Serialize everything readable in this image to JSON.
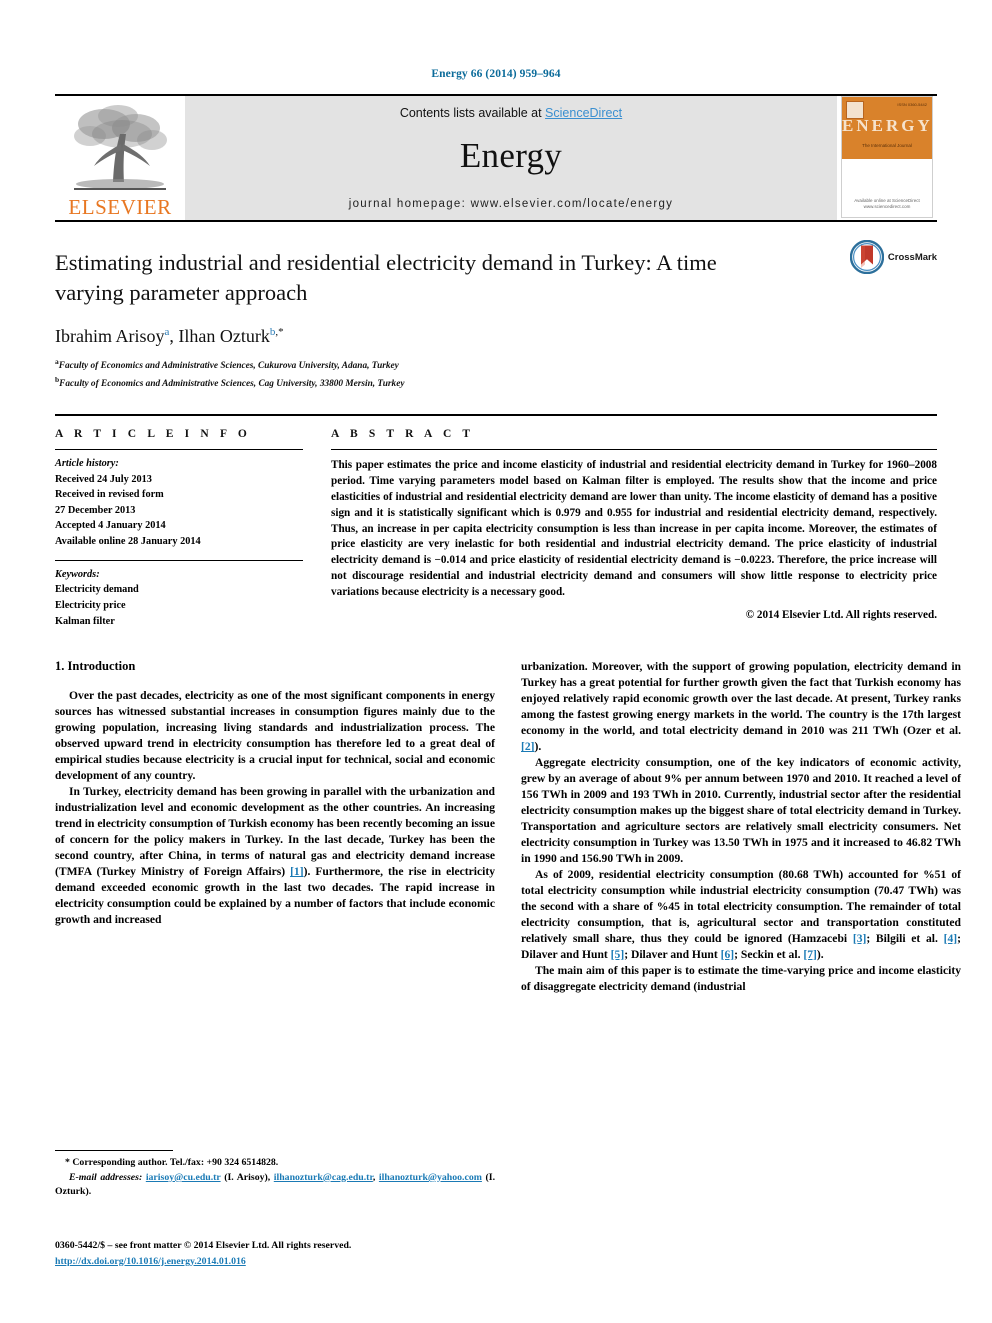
{
  "running_head": "Energy 66 (2014) 959–964",
  "masthead": {
    "publisher_name": "ELSEVIER",
    "contents_prefix": "Contents lists available at ",
    "sciencedirect": "ScienceDirect",
    "journal_name": "Energy",
    "homepage": "journal homepage: www.elsevier.com/locate/energy",
    "cover": {
      "title": "ENERGY",
      "issn": "ISSN 0360-5442",
      "subtitle": "The International Journal",
      "footer": "Available online at\nScienceDirect\nwww.sciencedirect.com"
    }
  },
  "article": {
    "title": "Estimating industrial and residential electricity demand in Turkey: A time varying parameter approach",
    "authors_plain": "Ibrahim Arisoy",
    "author1": "Ibrahim Arisoy",
    "author1_sup": "a",
    "author2": "Ilhan Ozturk",
    "author2_sup": "b",
    "author2_star": ",*",
    "affiliation_a_sup": "a",
    "affiliation_a": "Faculty of Economics and Administrative Sciences, Cukurova University, Adana, Turkey",
    "affiliation_b_sup": "b",
    "affiliation_b": "Faculty of Economics and Administrative Sciences, Cag University, 33800 Mersin, Turkey",
    "crossmark_label": "CrossMark"
  },
  "article_info": {
    "heading": "A R T I C L E   I N F O",
    "history_label": "Article history:",
    "history": [
      "Received 24 July 2013",
      "Received in revised form",
      "27 December 2013",
      "Accepted 4 January 2014",
      "Available online 28 January 2014"
    ],
    "keywords_label": "Keywords:",
    "keywords": [
      "Electricity demand",
      "Electricity price",
      "Kalman filter"
    ]
  },
  "abstract": {
    "heading": "A B S T R A C T",
    "text": "This paper estimates the price and income elasticity of industrial and residential electricity demand in Turkey for 1960–2008 period. Time varying parameters model based on Kalman filter is employed. The results show that the income and price elasticities of industrial and residential electricity demand are lower than unity. The income elasticity of demand has a positive sign and it is statistically significant which is 0.979 and 0.955 for industrial and residential electricity demand, respectively. Thus, an increase in per capita electricity consumption is less than increase in per capita income. Moreover, the estimates of price elasticity are very inelastic for both residential and industrial electricity demand. The price elasticity of industrial electricity demand is −0.014 and price elasticity of residential electricity demand is −0.0223. Therefore, the price increase will not discourage residential and industrial electricity demand and consumers will show little response to electricity price variations because electricity is a necessary good.",
    "copyright": "© 2014 Elsevier Ltd. All rights reserved."
  },
  "body": {
    "section_heading": "1. Introduction",
    "left_paragraphs": [
      "Over the past decades, electricity as one of the most significant components in energy sources has witnessed substantial increases in consumption figures mainly due to the growing population, increasing living standards and industrialization process. The observed upward trend in electricity consumption has therefore led to a great deal of empirical studies because electricity is a crucial input for technical, social and economic development of any country."
    ],
    "left_p2_part1": "In Turkey, electricity demand has been growing in parallel with the urbanization and industrialization level and economic development as the other countries. An increasing trend in electricity consumption of Turkish economy has been recently becoming an issue of concern for the policy makers in Turkey. In the last decade, Turkey has been the second country, after China, in terms of natural gas and electricity demand increase (TMFA (Turkey Ministry of Foreign Affairs) ",
    "left_p2_ref": "[1]",
    "left_p2_part2": "). Furthermore, the rise in electricity demand exceeded economic growth in the last two decades. The rapid increase in electricity consumption could be explained by a number of factors that include economic growth and increased",
    "right_p1_part1": "urbanization. Moreover, with the support of growing population, electricity demand in Turkey has a great potential for further growth given the fact that Turkish economy has enjoyed relatively rapid economic growth over the last decade. At present, Turkey ranks among the fastest growing energy markets in the world. The country is the 17th largest economy in the world, and total electricity demand in 2010 was 211 TWh (Ozer et al. ",
    "right_p1_ref": "[2]",
    "right_p1_part2": ").",
    "right_p2": "Aggregate electricity consumption, one of the key indicators of economic activity, grew by an average of about 9% per annum between 1970 and 2010. It reached a level of 156 TWh in 2009 and 193 TWh in 2010. Currently, industrial sector after the residential electricity consumption makes up the biggest share of total electricity demand in Turkey. Transportation and agriculture sectors are relatively small electricity consumers. Net electricity consumption in Turkey was 13.50 TWh in 1975 and it increased to 46.82 TWh in 1990 and 156.90 TWh in 2009.",
    "right_p3_part1": "As of 2009, residential electricity consumption (80.68 TWh) accounted for %51 of total electricity consumption while industrial electricity consumption (70.47 TWh) was the second with a share of %45 in total electricity consumption. The remainder of total electricity consumption, that is, agricultural sector and transportation constituted relatively small share, thus they could be ignored (Hamzacebi ",
    "right_p3_ref1": "[3]",
    "right_p3_mid1": "; Bilgili et al. ",
    "right_p3_ref2": "[4]",
    "right_p3_mid2": "; Dilaver and Hunt ",
    "right_p3_ref3": "[5]",
    "right_p3_mid3": "; Dilaver and Hunt ",
    "right_p3_ref4": "[6]",
    "right_p3_mid4": "; Seckin et al. ",
    "right_p3_ref5": "[7]",
    "right_p3_end": ").",
    "right_p4": "The main aim of this paper is to estimate the time-varying price and income elasticity of disaggregate electricity demand (industrial"
  },
  "footnotes": {
    "corresponding": "* Corresponding author. Tel./fax: +90 324 6514828.",
    "email_label": "E-mail addresses:",
    "email1": "iarisoy@cu.edu.tr",
    "email1_name": "(I. Arisoy)",
    "email2": "ilhanozturk@cag.edu.tr",
    "email3": "ilhanozturk@yahoo.com",
    "email3_name": "(I. Ozturk)"
  },
  "imprint": {
    "line1": "0360-5442/$ – see front matter © 2014 Elsevier Ltd. All rights reserved.",
    "doi": "http://dx.doi.org/10.1016/j.energy.2014.01.016"
  },
  "colors": {
    "link": "#1a7ab5",
    "running_head": "#0b6b9a",
    "elsevier_orange": "#E87722",
    "masthead_gray": "#e3e3e3",
    "cover_orange": "#d9822b"
  }
}
